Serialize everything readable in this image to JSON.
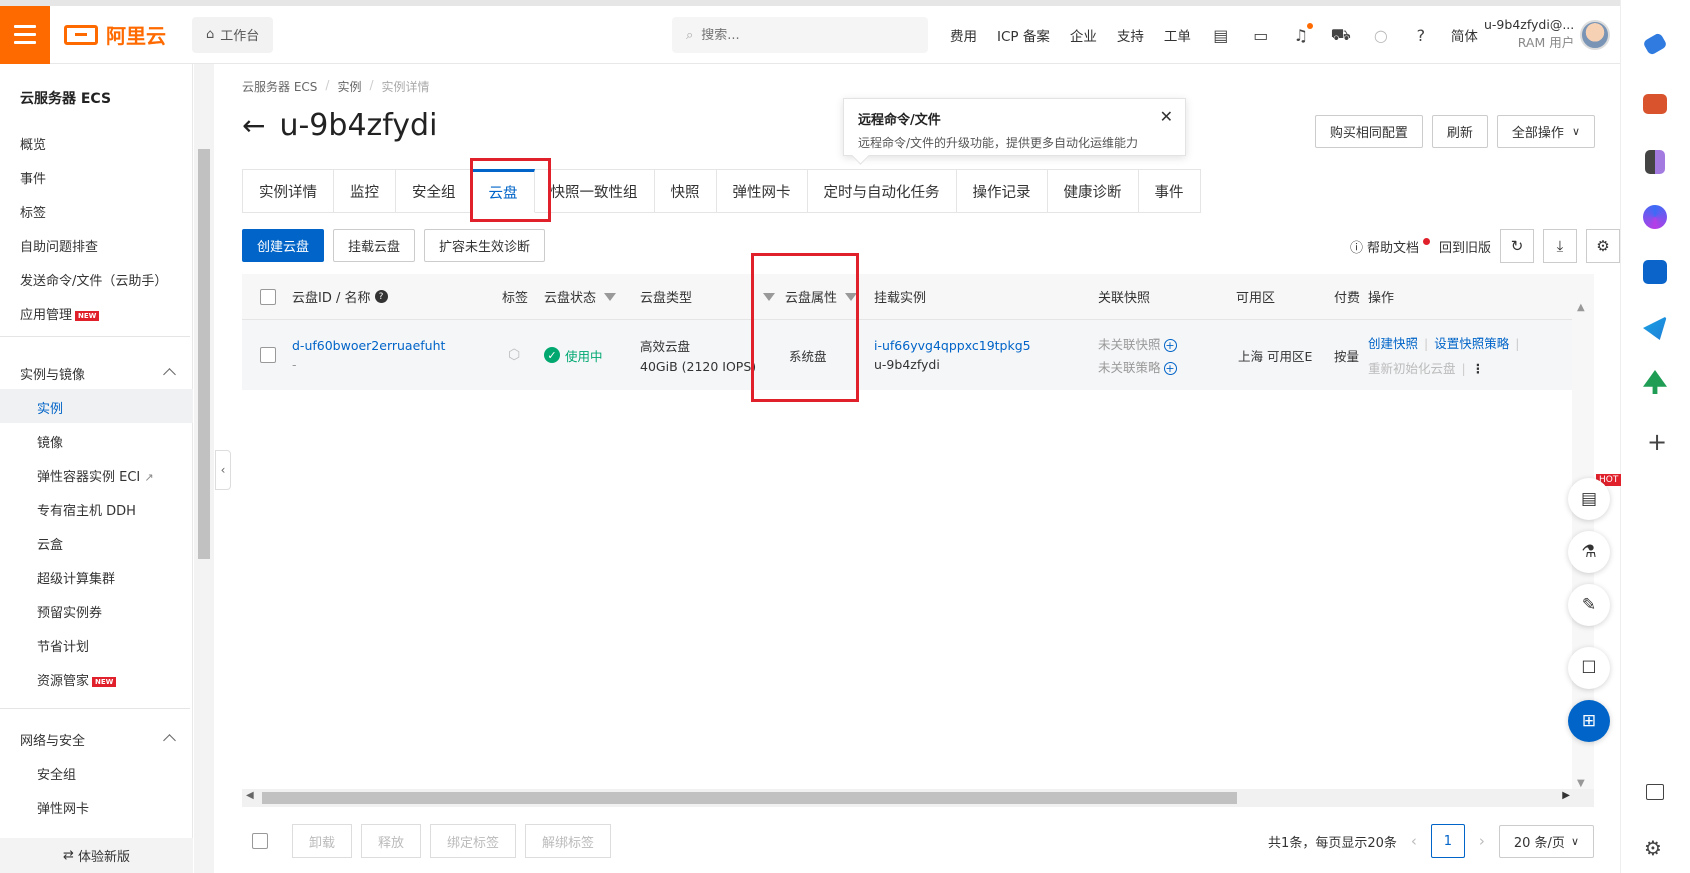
{
  "topbar": {
    "logo": "阿里云",
    "workbench": "工作台",
    "search_placeholder": "搜索...",
    "links": [
      "费用",
      "ICP 备案",
      "企业",
      "支持",
      "工单"
    ],
    "lang": "简体",
    "user_name": "u-9b4zfydi@...",
    "user_role": "RAM 用户"
  },
  "sidebar": {
    "title": "云服务器 ECS",
    "top_items": [
      "概览",
      "事件",
      "标签",
      "自助问题排查",
      "发送命令/文件（云助手）",
      "应用管理"
    ],
    "new_badge": "NEW",
    "section1": "实例与镜像",
    "section1_items": [
      "实例",
      "镜像",
      "弹性容器实例 ECI",
      "专有宿主机 DDH",
      "云盒",
      "超级计算集群",
      "预留实例券",
      "节省计划",
      "资源管家"
    ],
    "section2": "网络与安全",
    "section2_items": [
      "安全组",
      "弹性网卡"
    ],
    "new_version": "体验新版"
  },
  "breadcrumb": [
    "云服务器 ECS",
    "实例",
    "实例详情"
  ],
  "page_title": "u-9b4zfydi",
  "popover": {
    "title": "远程命令/文件",
    "desc": "远程命令/文件的升级功能，提供更多自动化运维能力"
  },
  "header_buttons": [
    "购买相同配置",
    "刷新",
    "全部操作"
  ],
  "tabs": [
    "实例详情",
    "监控",
    "安全组",
    "云盘",
    "快照一致性组",
    "快照",
    "弹性网卡",
    "定时与自动化任务",
    "操作记录",
    "健康诊断",
    "事件"
  ],
  "active_tab": "云盘",
  "toolbar": {
    "create": "创建云盘",
    "attach": "挂载云盘",
    "diagnose": "扩容未生效诊断",
    "help": "帮助文档",
    "old_version": "回到旧版"
  },
  "table": {
    "headers": {
      "id_name": "云盘ID / 名称",
      "tags": "标签",
      "status": "云盘状态",
      "type": "云盘类型",
      "attribute": "云盘属性",
      "instance": "挂载实例",
      "snapshot": "关联快照",
      "zone": "可用区",
      "billing": "付费",
      "actions": "操作"
    },
    "rows": [
      {
        "id": "d-uf60bwoer2erruaefuht",
        "name": "-",
        "status": "使用中",
        "type": "高效云盘",
        "size": "40GiB (2120 IOPS)",
        "attribute": "系统盘",
        "instance_id": "i-uf66yvg4qppxc19tpkg5",
        "instance_name": "u-9b4zfydi",
        "snapshot": "未关联快照",
        "policy": "未关联策略",
        "zone": "上海 可用区E",
        "billing": "按量",
        "action1": "创建快照",
        "action2": "设置快照策略",
        "action3": "重新初始化云盘"
      }
    ]
  },
  "footer": {
    "buttons": [
      "卸载",
      "释放",
      "绑定标签",
      "解绑标签"
    ],
    "summary": "共1条，每页显示20条",
    "page": "1",
    "page_size": "20 条/页"
  },
  "float": {
    "hot": "HOT"
  }
}
